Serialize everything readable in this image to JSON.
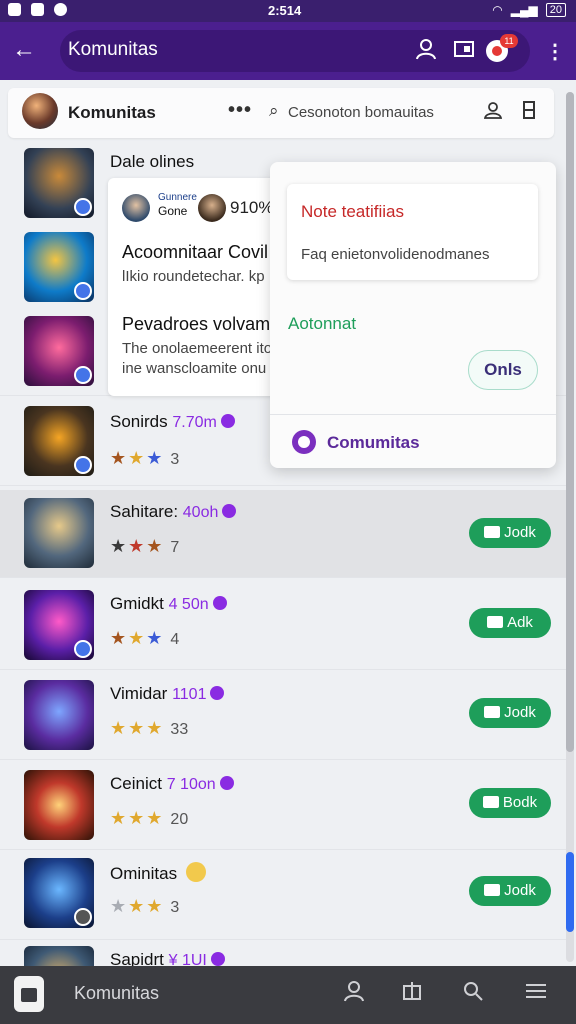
{
  "statusbar": {
    "time": "2:514",
    "battery": "20"
  },
  "appbar": {
    "title": "Komunitas",
    "notif_count": "11"
  },
  "community_header": {
    "name": "Komunitas",
    "more": "•••",
    "search_placeholder": "Cesonoton bomauitas"
  },
  "card": {
    "top_title": "Dale olines",
    "mini_label_1": "Gunnere",
    "mini_label_2": "Gone",
    "pct": "910%",
    "title1": "Acoomnitaar Covil",
    "sub1": "lIkio roundetechar. kp",
    "title2": "Pevadroes volvamt",
    "sub2": "The onolaemeerent itoni",
    "sub3": "ine wanscloamite onu"
  },
  "popup": {
    "inner_title": "Note teatifiias",
    "inner_text": "Faq enietonvolidenodmanes",
    "green_label": "Aotonnat",
    "pill_label": "Onls",
    "footer_label": "Comumitas"
  },
  "rows": [
    {
      "title": "Sonirds",
      "tag": "7.70m",
      "count": "3",
      "button": ""
    },
    {
      "title": "Sahitare:",
      "tag": "40oh",
      "count": "7",
      "button": "Jodk"
    },
    {
      "title": "Gmidkt",
      "tag": "4 50n",
      "count": "4",
      "button": "Adk"
    },
    {
      "title": "Vimidar",
      "tag": "1101",
      "count": "33",
      "button": "Jodk"
    },
    {
      "title": "Ceinict",
      "tag": "7 10on",
      "count": "20",
      "button": "Bodk"
    },
    {
      "title": "Ominitas",
      "tag": "",
      "count": "3",
      "button": "Jodk"
    },
    {
      "title": "Sapidrt",
      "tag": "¥ 1UI",
      "count": "",
      "button": ""
    }
  ],
  "bottombar": {
    "title": "Komunitas"
  },
  "colors": {
    "primary": "#4b1f8f",
    "join_green": "#1e9e5a",
    "alert_red": "#c62828",
    "tag_purple": "#8a2be2"
  }
}
